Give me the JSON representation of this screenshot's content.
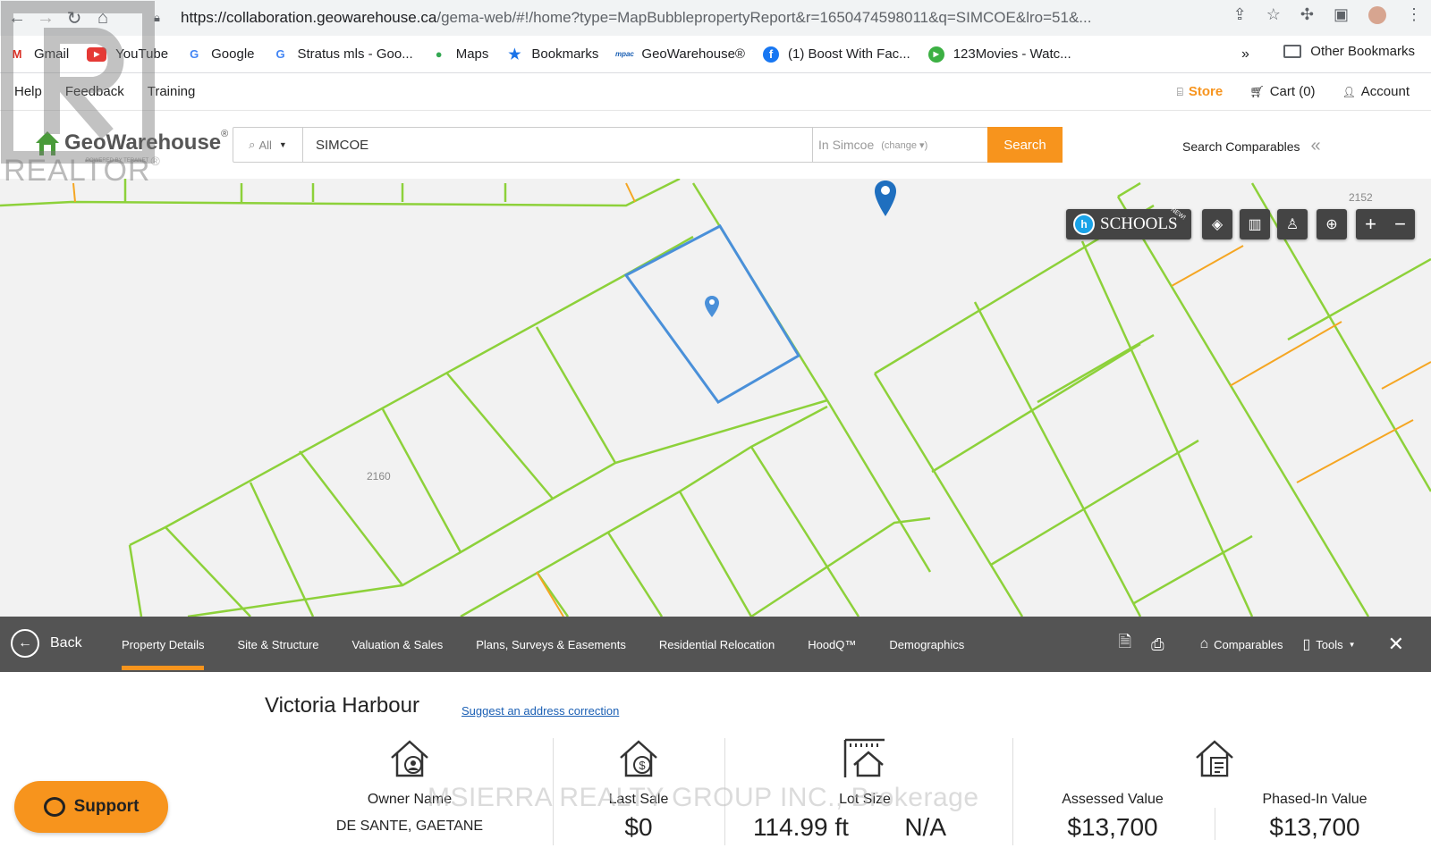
{
  "browser": {
    "url_host": "https://collaboration.geowarehouse.ca",
    "url_path": "/gema-web/#!/home?type=MapBubblepropertyReport&r=1650474598011&q=SIMCOE&lro=51&..."
  },
  "bookmarks": {
    "items": [
      {
        "label": "Gmail",
        "icon": "gmail-icon"
      },
      {
        "label": "YouTube",
        "icon": "youtube-icon"
      },
      {
        "label": "Google",
        "icon": "google-icon"
      },
      {
        "label": "Stratus mls - Goo...",
        "icon": "google-icon"
      },
      {
        "label": "Maps",
        "icon": "maps-icon"
      },
      {
        "label": "Bookmarks",
        "icon": "star-icon"
      },
      {
        "label": "GeoWarehouse®",
        "icon": "mpac-icon"
      },
      {
        "label": "(1) Boost With Fac...",
        "icon": "facebook-icon"
      },
      {
        "label": "123Movies - Watc...",
        "icon": "play-icon"
      }
    ],
    "more": "»",
    "other": "Other Bookmarks"
  },
  "topnav": {
    "help": "Help",
    "feedback": "Feedback",
    "training": "Training",
    "store": "Store",
    "cart": "Cart (0)",
    "account": "Account"
  },
  "header": {
    "logo": "GeoWarehouse",
    "logo_mark": "®",
    "logo_sub": "POWERED BY TERANET",
    "search_scope": "All",
    "search_value": "SIMCOE",
    "location_prefix": "In Simcoe",
    "location_change": "(change ▾)",
    "search_button": "Search",
    "comparables": "Search Comparables"
  },
  "map": {
    "label_1": "2152",
    "label_2": "2160",
    "schools": "SCHOOLS",
    "schools_badge": "NEW!"
  },
  "tabbar": {
    "back": "Back",
    "tabs": [
      "Property Details",
      "Site & Structure",
      "Valuation & Sales",
      "Plans, Surveys & Easements",
      "Residential Relocation",
      "HoodQ™",
      "Demographics"
    ],
    "comparables": "Comparables",
    "tools": "Tools"
  },
  "property": {
    "town": "Victoria Harbour",
    "suggest": "Suggest an address correction",
    "owner_label": "Owner Name",
    "owner_value": "DE SANTE, GAETANE",
    "sale_label": "Last Sale",
    "sale_value": "$0",
    "lot_label": "Lot Size",
    "lot_value": "114.99 ft",
    "lot_value2": "N/A",
    "assessed_label": "Assessed Value",
    "assessed_value": "$13,700",
    "phased_label": "Phased-In Value",
    "phased_value": "$13,700"
  },
  "overlay": {
    "watermark": "MSIERRA REALTY GROUP INC., Brokerage",
    "realtor": "REALTOR",
    "realtor_mark": "®",
    "support": "Support"
  },
  "colors": {
    "accent": "#f7941d",
    "parcel_line": "#8dd13a",
    "selected_parcel": "#4a90d9",
    "tabbar": "#545454"
  }
}
